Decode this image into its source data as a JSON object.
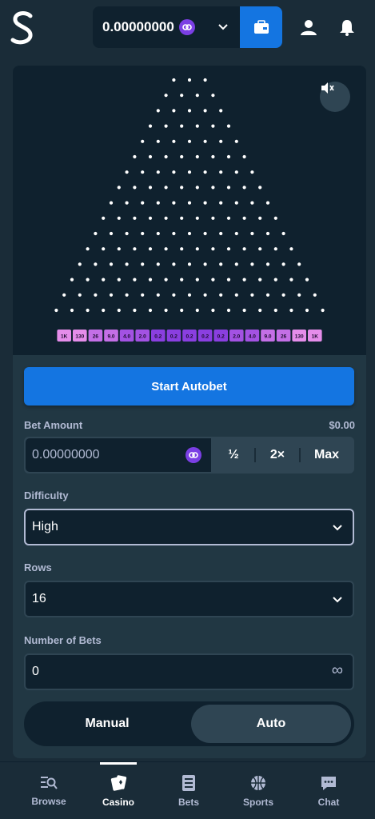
{
  "header": {
    "balance": "0.00000000",
    "currency_icon": "coin-icon",
    "wallet_icon": "wallet-icon",
    "user_icon": "user-icon",
    "bell_icon": "bell-icon"
  },
  "game": {
    "rows": 16,
    "multipliers": [
      "1K",
      "130",
      "26",
      "9.0",
      "4.0",
      "2.0",
      "0.2",
      "0.2",
      "0.2",
      "0.2",
      "0.2",
      "2.0",
      "4.0",
      "9.0",
      "26",
      "130",
      "1K"
    ]
  },
  "controls": {
    "start_autobet": "Start Autobet",
    "bet_amount_label": "Bet Amount",
    "bet_amount_usd": "$0.00",
    "bet_amount_value": "0.00000000",
    "half_label": "½",
    "double_label": "2×",
    "max_label": "Max",
    "difficulty_label": "Difficulty",
    "difficulty_value": "High",
    "rows_label": "Rows",
    "rows_value": "16",
    "num_bets_label": "Number of Bets",
    "num_bets_value": "0",
    "infinity_symbol": "∞",
    "manual_label": "Manual",
    "auto_label": "Auto"
  },
  "nav": {
    "items": [
      {
        "label": "Browse",
        "icon": "browse-icon"
      },
      {
        "label": "Casino",
        "icon": "casino-icon"
      },
      {
        "label": "Bets",
        "icon": "bets-icon"
      },
      {
        "label": "Sports",
        "icon": "sports-icon"
      },
      {
        "label": "Chat",
        "icon": "chat-icon"
      }
    ]
  },
  "colors": {
    "background": "#1a2c38",
    "panel": "#213743",
    "dark": "#0f212e",
    "accent_blue": "#1475e1",
    "text_muted": "#b1bad3"
  }
}
